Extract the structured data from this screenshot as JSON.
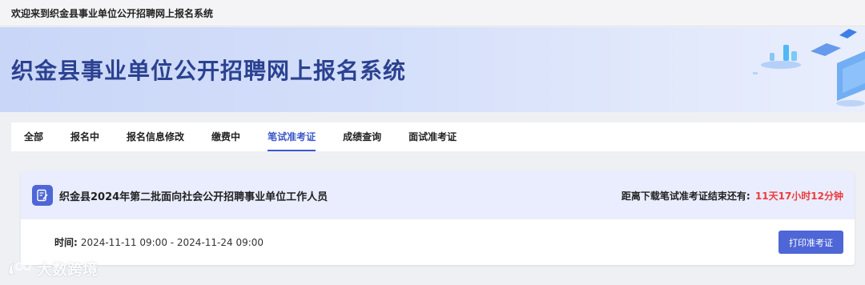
{
  "topbar": {
    "welcome": "欢迎来到织金县事业单位公开招聘网上报名系统"
  },
  "banner": {
    "title": "织金县事业单位公开招聘网上报名系统"
  },
  "tabs": [
    {
      "label": "全部"
    },
    {
      "label": "报名中"
    },
    {
      "label": "报名信息修改"
    },
    {
      "label": "缴费中"
    },
    {
      "label": "笔试准考证",
      "active": true
    },
    {
      "label": "成绩查询"
    },
    {
      "label": "面试准考证"
    }
  ],
  "exam": {
    "title": "织金县2024年第二批面向社会公开招聘事业单位工作人员",
    "countdown_label": "距离下载笔试准考证结束还有:",
    "countdown_value": "11天17小时12分钟",
    "time_label": "时间:",
    "time_value": "2024-11-11 09:00 - 2024-11-24 09:00",
    "print_button": "打印准考证"
  },
  "watermark": {
    "text": "大数跨境"
  },
  "colors": {
    "accent": "#3d58c8",
    "button": "#4e66d6",
    "countdown": "#ef3b3b",
    "banner_title": "#2b4190"
  }
}
